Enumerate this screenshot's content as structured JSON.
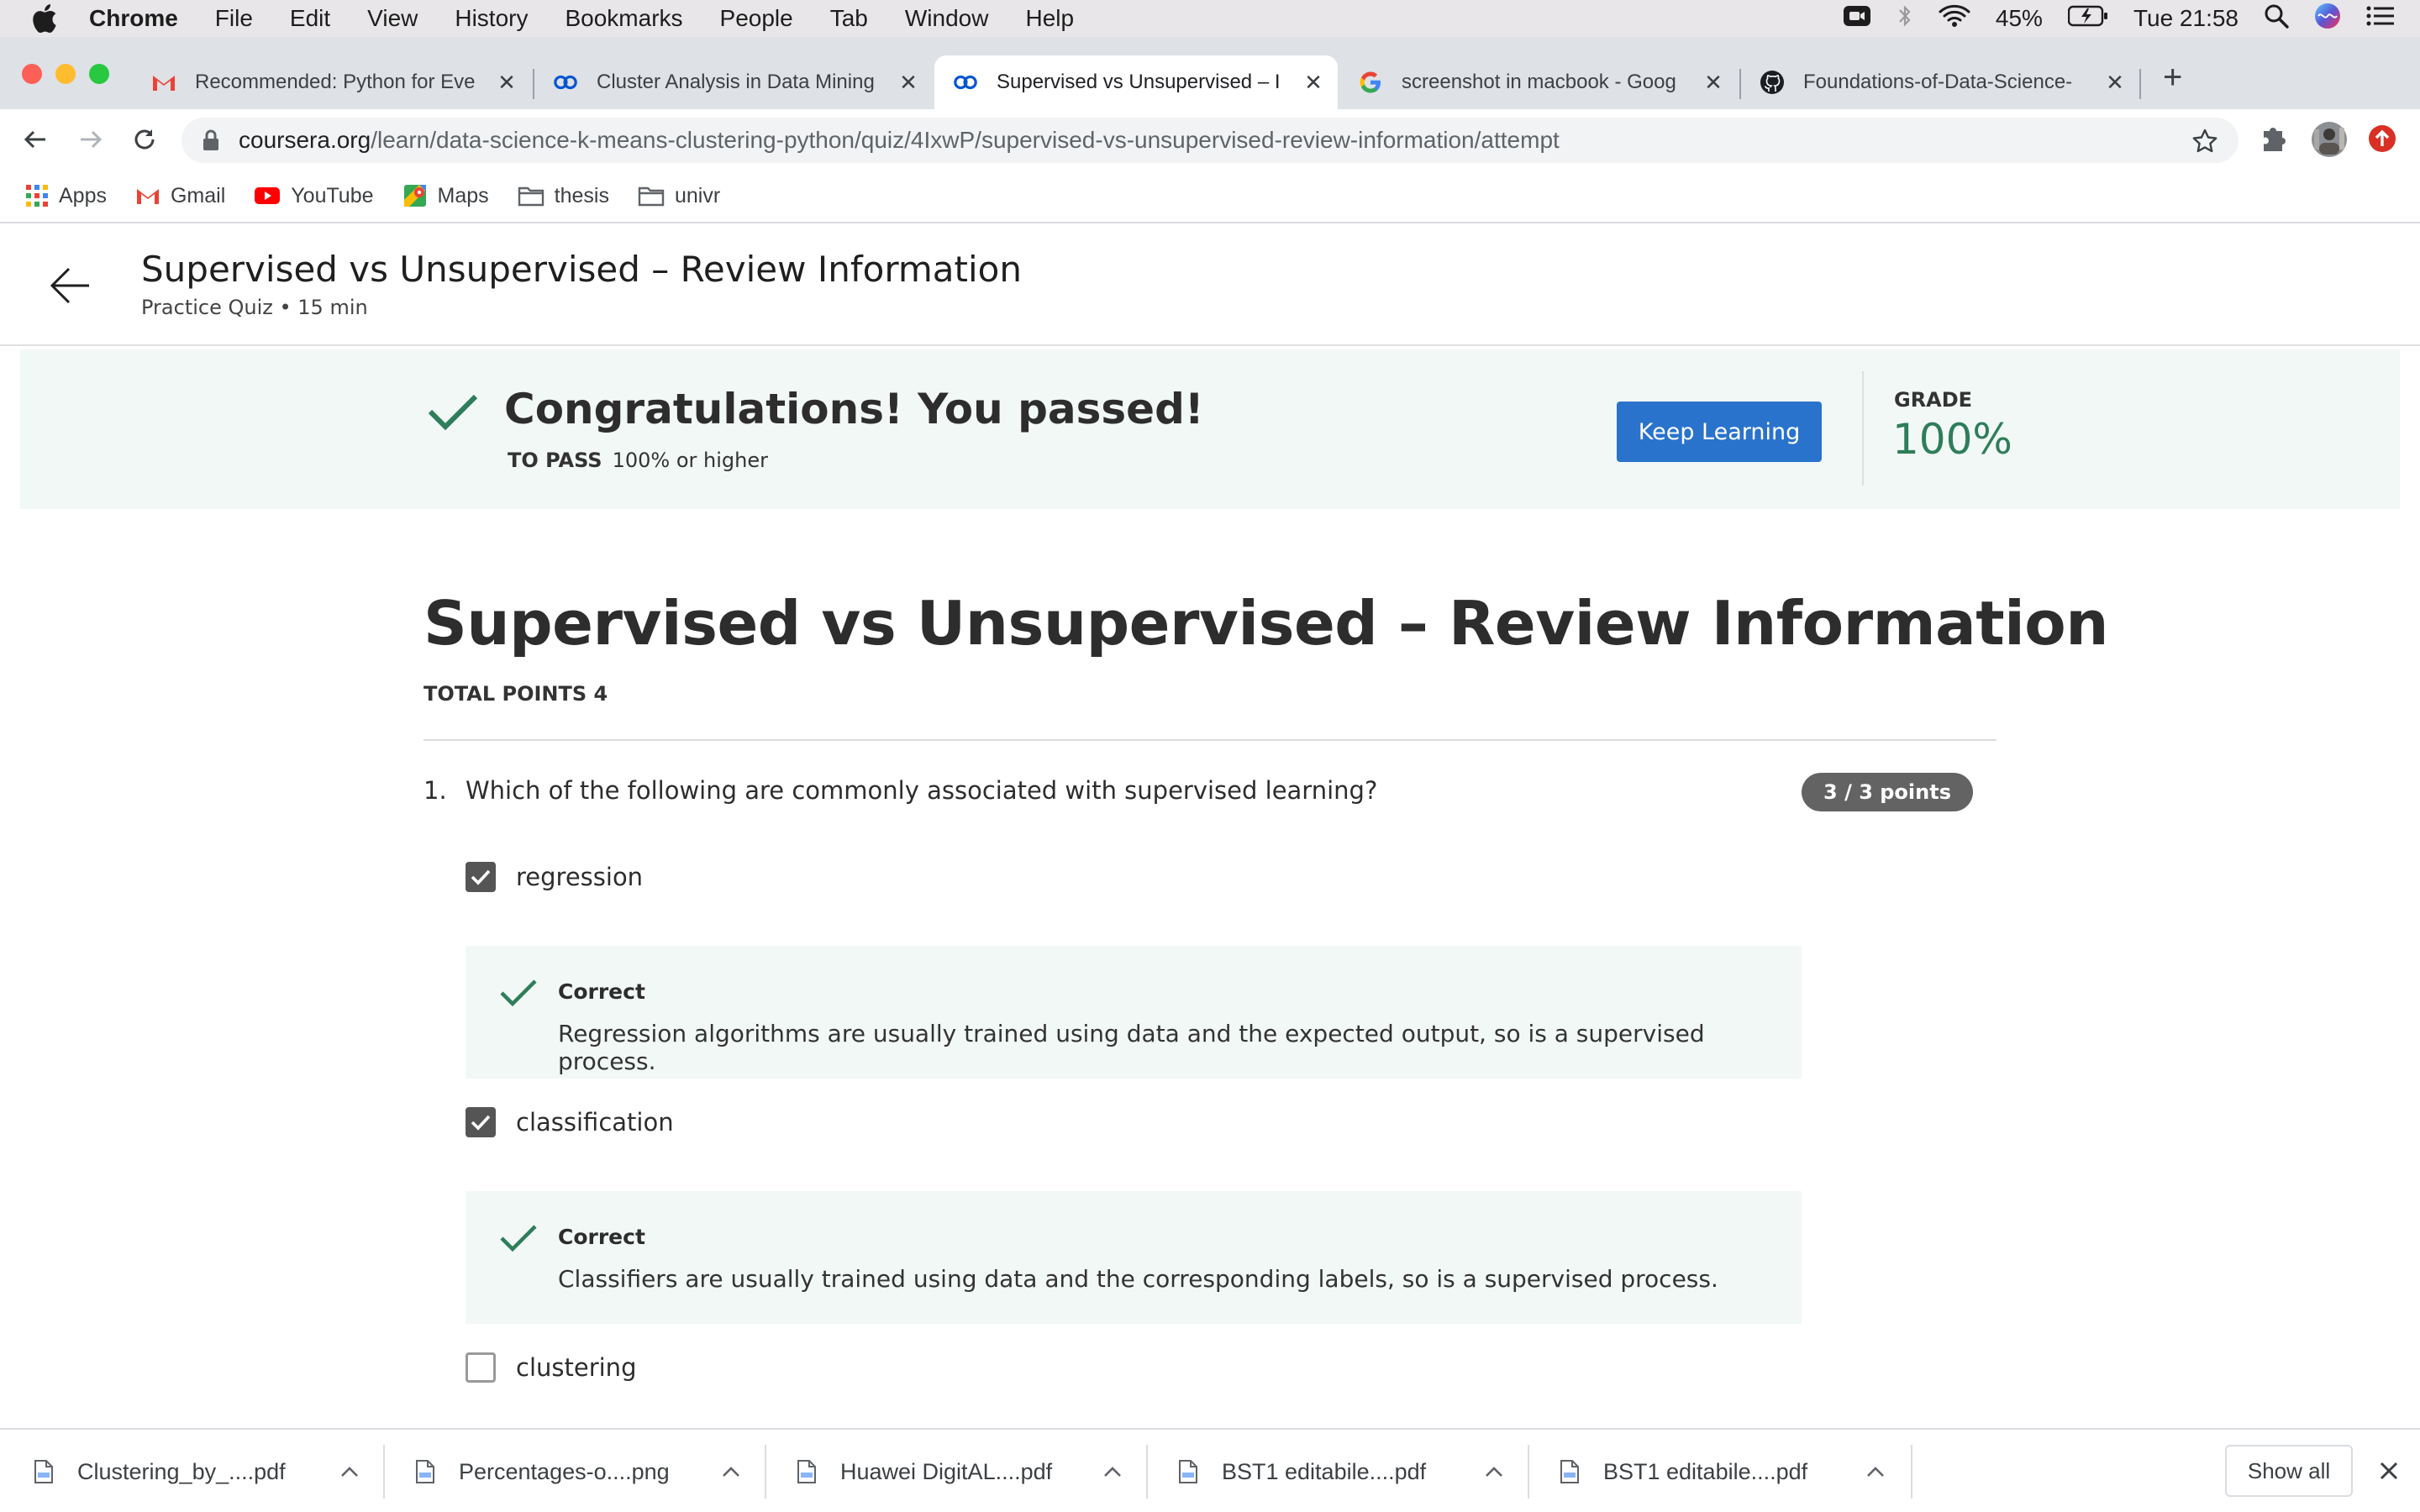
{
  "menubar": {
    "app": "Chrome",
    "items": [
      "File",
      "Edit",
      "View",
      "History",
      "Bookmarks",
      "People",
      "Tab",
      "Window",
      "Help"
    ],
    "battery": "45%",
    "clock": "Tue 21:58"
  },
  "tabs": [
    {
      "title": "Recommended: Python for Eve",
      "icon": "gmail-icon"
    },
    {
      "title": "Cluster Analysis in Data Mining",
      "icon": "coursera-icon"
    },
    {
      "title": "Supervised vs Unsupervised – I",
      "icon": "coursera-icon"
    },
    {
      "title": "screenshot in macbook - Goog",
      "icon": "google-icon"
    },
    {
      "title": "Foundations-of-Data-Science-",
      "icon": "github-icon"
    }
  ],
  "address": {
    "host": "coursera.org",
    "path": "/learn/data-science-k-means-clustering-python/quiz/4IxwP/supervised-vs-unsupervised-review-information/attempt"
  },
  "bookmarks": [
    "Apps",
    "Gmail",
    "YouTube",
    "Maps",
    "thesis",
    "univr"
  ],
  "header": {
    "title": "Supervised vs Unsupervised – Review Information",
    "subtitle": "Practice Quiz • 15 min"
  },
  "banner": {
    "message": "Congratulations! You passed!",
    "to_pass_label": "TO PASS",
    "to_pass_value": "100% or higher",
    "button": "Keep Learning",
    "grade_label": "GRADE",
    "grade_value": "100%"
  },
  "quiz": {
    "title": "Supervised vs Unsupervised – Review Information",
    "total_points": "TOTAL POINTS 4",
    "question": {
      "number": "1.",
      "text": "Which of the following are commonly associated with supervised learning?",
      "points": "3 / 3 points",
      "options": [
        {
          "label": "regression",
          "checked": true,
          "feedback_label": "Correct",
          "feedback": "Regression algorithms are usually trained using data and the expected output, so is a supervised process."
        },
        {
          "label": "classification",
          "checked": true,
          "feedback_label": "Correct",
          "feedback": "Classifiers are usually trained using data and the corresponding labels, so is a supervised process."
        },
        {
          "label": "clustering",
          "checked": false
        }
      ]
    }
  },
  "downloads": {
    "files": [
      "Clustering_by_....pdf",
      "Percentages-o....png",
      "Huawei DigitAL....pdf",
      "BST1 editabile....pdf",
      "BST1 editabile....pdf"
    ],
    "show_all": "Show all"
  },
  "colors": {
    "accent_green": "#2e7d5b",
    "button_blue": "#2a73cc",
    "banner_bg": "#f2f8f6"
  }
}
